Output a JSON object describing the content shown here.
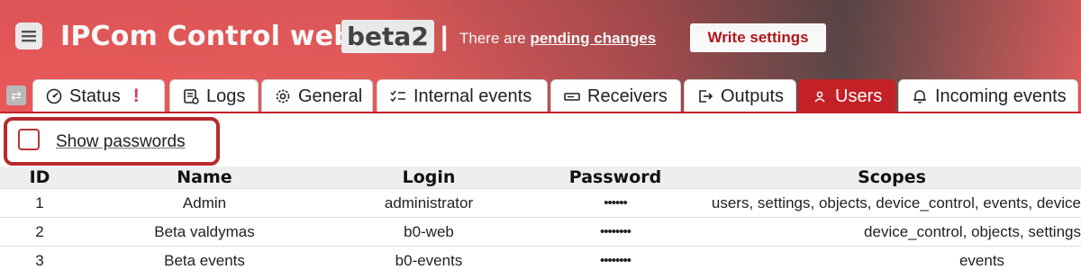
{
  "header": {
    "title": "IPCom Control web",
    "badge": "beta2",
    "separator": "|",
    "pending_prefix": "There are",
    "pending_link": "pending changes",
    "write_button": "Write settings",
    "colors": {
      "accent": "#c32126",
      "header_red": "#e8585a",
      "pending_alert": "#e0306e"
    }
  },
  "tabs": [
    {
      "label": "Status",
      "icon": "gauge-icon",
      "alert": "!"
    },
    {
      "label": "Logs",
      "icon": "log-icon"
    },
    {
      "label": "General",
      "icon": "gear-icon"
    },
    {
      "label": "Internal events",
      "icon": "checklist-icon"
    },
    {
      "label": "Receivers",
      "icon": "receiver-icon"
    },
    {
      "label": "Outputs",
      "icon": "output-icon"
    },
    {
      "label": "Users",
      "icon": "user-icon",
      "active": true
    },
    {
      "label": "Incoming events",
      "icon": "bell-icon"
    }
  ],
  "options": {
    "show_passwords_label": "Show passwords",
    "show_passwords_checked": false
  },
  "table": {
    "columns": [
      "ID",
      "Name",
      "Login",
      "Password",
      "Scopes"
    ],
    "rows": [
      {
        "id": "1",
        "name": "Admin",
        "login": "administrator",
        "password": "••••••",
        "scopes": "users, settings, objects, device_control, events, device"
      },
      {
        "id": "2",
        "name": "Beta valdymas",
        "login": "b0-web",
        "password": "••••••••",
        "scopes": "device_control, objects, settings"
      },
      {
        "id": "3",
        "name": "Beta events",
        "login": "b0-events",
        "password": "••••••••",
        "scopes": "events"
      }
    ]
  }
}
